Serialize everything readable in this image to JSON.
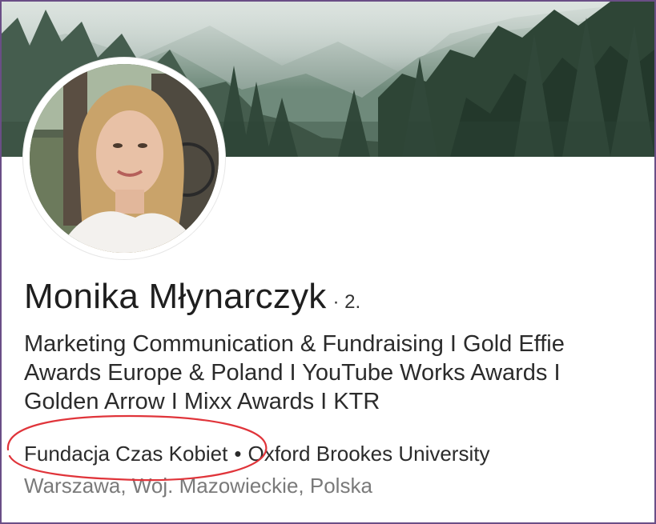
{
  "profile": {
    "name": "Monika Młynarczyk",
    "degree": "· 2.",
    "headline": "Marketing Communication & Fundraising I Gold Effie Awards Europe & Poland I YouTube Works Awards I Golden Arrow I Mixx Awards I KTR",
    "company": "Fundacja Czas Kobiet",
    "separator": "•",
    "school": "Oxford Brookes University",
    "location": "Warszawa, Woj. Mazowieckie, Polska"
  },
  "colors": {
    "annotation": "#e0343a",
    "frame": "#6a4e86"
  },
  "icons": [
    "cover-photo",
    "profile-photo"
  ]
}
